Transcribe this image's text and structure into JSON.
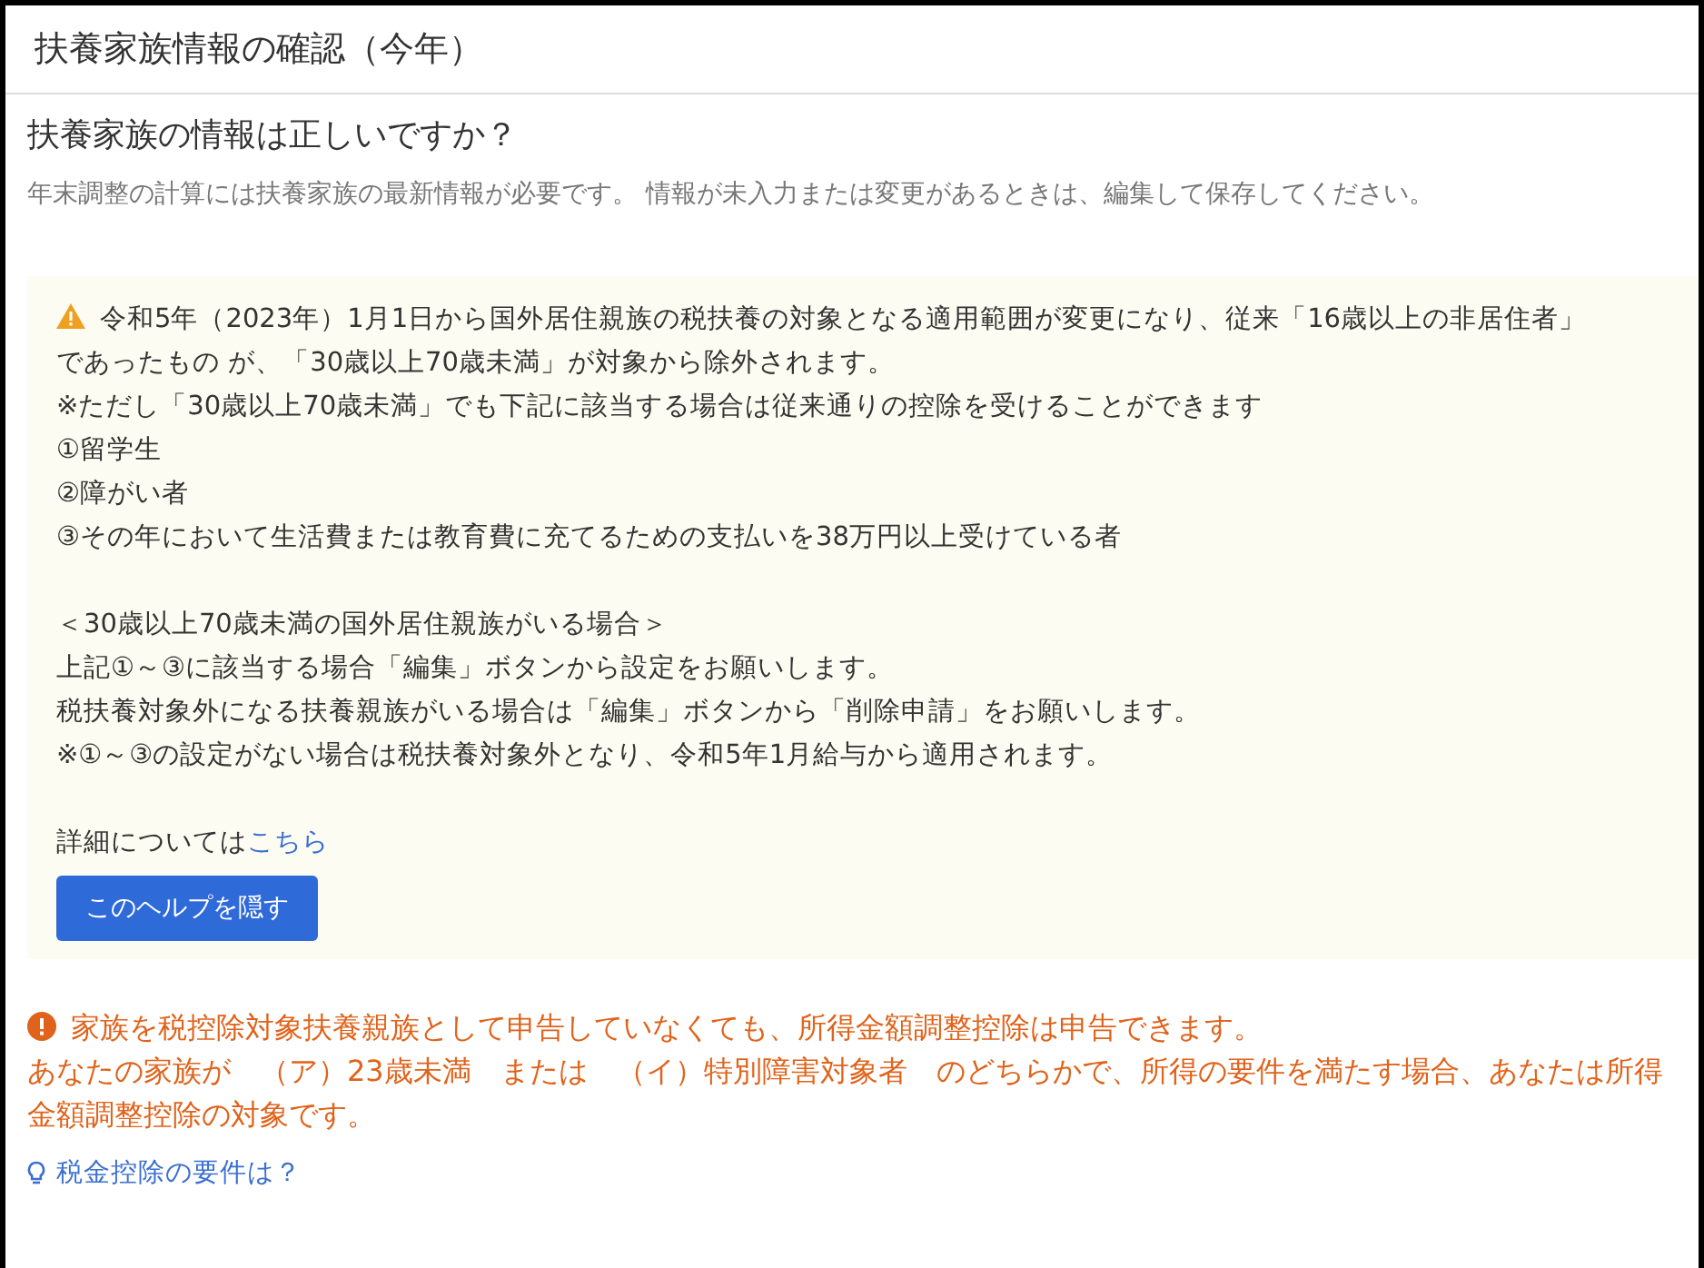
{
  "header": {
    "title": "扶養家族情報の確認（今年）"
  },
  "question": "扶養家族の情報は正しいですか？",
  "description": "年末調整の計算には扶養家族の最新情報が必要です。 情報が未入力または変更があるときは、編集して保存してください。",
  "help": {
    "lines": [
      {
        "kind": "warning",
        "text": "令和5年（2023年）1月1日から国外居住親族の税扶養の対象となる適用範囲が変更になり、従来「16歳以上の非居住者」"
      },
      {
        "kind": "text",
        "text": "であったもの が、「30歳以上70歳未満」が対象から除外されます。"
      },
      {
        "kind": "text",
        "text": "※ただし「30歳以上70歳未満」でも下記に該当する場合は従来通りの控除を受けることができます"
      },
      {
        "kind": "text",
        "text": "①留学生"
      },
      {
        "kind": "text",
        "text": "②障がい者"
      },
      {
        "kind": "text",
        "text": "③その年において生活費または教育費に充てるための支払いを38万円以上受けている者"
      },
      {
        "kind": "blank"
      },
      {
        "kind": "text",
        "text": "＜30歳以上70歳未満の国外居住親族がいる場合＞"
      },
      {
        "kind": "text",
        "text": "上記①～③に該当する場合「編集」ボタンから設定をお願いします。"
      },
      {
        "kind": "text",
        "text": "税扶養対象外になる扶養親族がいる場合は「編集」ボタンから「削除申請」をお願いします。"
      },
      {
        "kind": "text",
        "text": "※①～③の設定がない場合は税扶養対象外となり、令和5年1月給与から適用されます。"
      },
      {
        "kind": "blank"
      },
      {
        "kind": "link",
        "text": "詳細については",
        "link": "こちら"
      }
    ],
    "button": "このヘルプを隠す"
  },
  "alert": {
    "title": "家族を税控除対象扶養親族として申告していなくても、所得金額調整控除は申告できます。",
    "body": "あなたの家族が　（ア）23歳未満　または　（イ）特別障害対象者　のどちらかで、所得の要件を満たす場合、あなたは所得金額調整控除の対象です。"
  },
  "tip_link": "税金控除の要件は？"
}
